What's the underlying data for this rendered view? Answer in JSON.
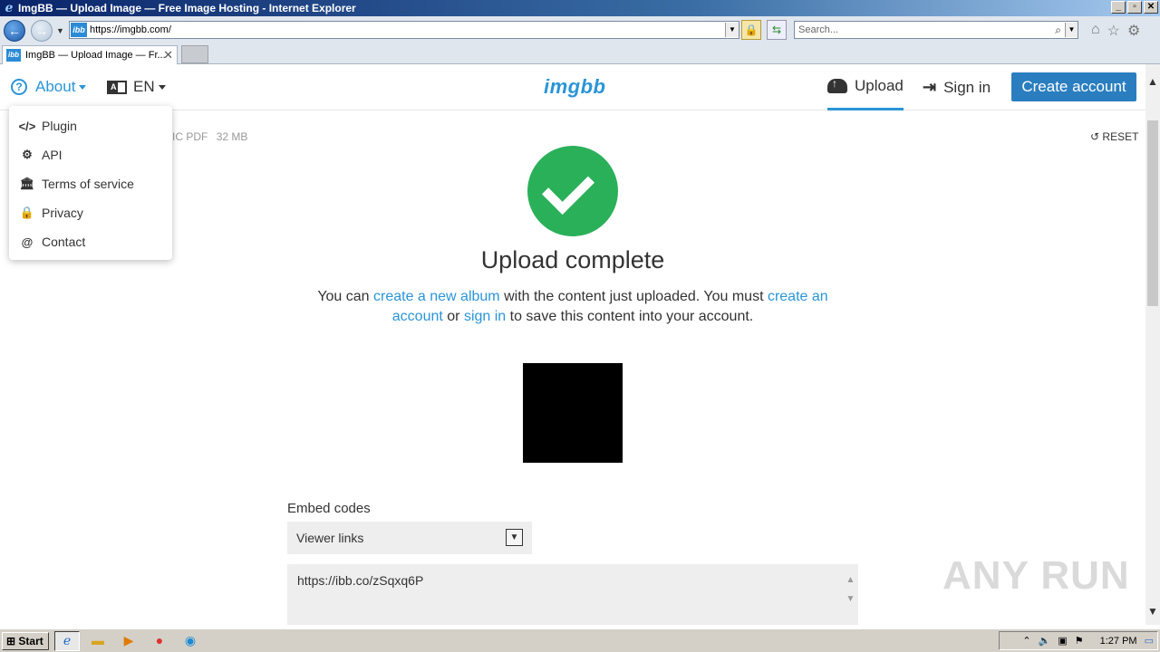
{
  "window": {
    "title": "ImgBB — Upload Image — Free Image Hosting - Internet Explorer",
    "minimize": "_",
    "restore": "▫",
    "close": "✕"
  },
  "browser": {
    "address": "https://imgbb.com/",
    "favicon": "ibb",
    "search_placeholder": "Search...",
    "tab_title": "ImgBB — Upload Image — Fr...",
    "tab_close": "✕"
  },
  "site": {
    "logo": "imgbb",
    "nav": {
      "about": "About",
      "language": "EN",
      "upload": "Upload",
      "signin": "Sign in",
      "create_account": "Create account"
    },
    "about_menu": [
      {
        "label": "Plugin",
        "icon": "code-icon"
      },
      {
        "label": "API",
        "icon": "gear-icon"
      },
      {
        "label": "Terms of service",
        "icon": "bank-icon"
      },
      {
        "label": "Privacy",
        "icon": "lock-icon"
      },
      {
        "label": "Contact",
        "icon": "at-icon"
      }
    ],
    "file_meta": {
      "types": "IC PDF",
      "size": "32 MB"
    },
    "reset": "RESET",
    "heading": "Upload complete",
    "desc": {
      "p1": "You can ",
      "link1": "create a new album",
      "p2": " with the content just uploaded. You must ",
      "link2": "create an account",
      "p3": " or ",
      "link3": "sign in",
      "p4": " to save this content into your account."
    },
    "embed": {
      "label": "Embed codes",
      "selected": "Viewer links",
      "code": "https://ibb.co/zSqxq6P"
    },
    "watermark": "ANY RUN"
  },
  "taskbar": {
    "start": "Start",
    "time": "1:27 PM"
  },
  "colors": {
    "accent": "#2a95d6",
    "button": "#2a7ebf",
    "success": "#2bb05a"
  }
}
